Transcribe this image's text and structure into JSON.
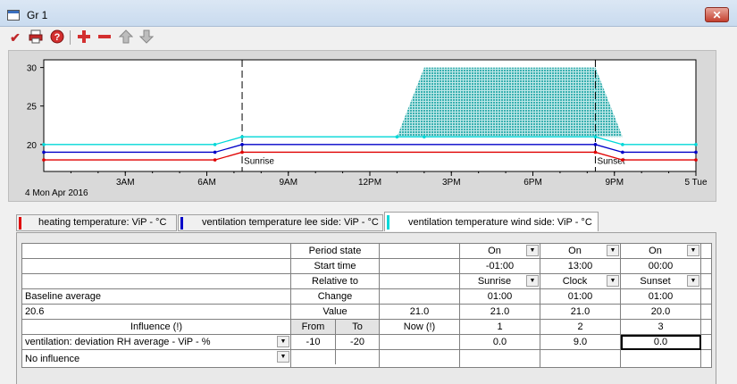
{
  "window": {
    "title": "Gr 1",
    "close_label": "✕"
  },
  "toolbar": {
    "icons": [
      "check-icon",
      "print-icon",
      "help-icon",
      "add-icon",
      "remove-icon",
      "move-up-icon",
      "move-down-icon"
    ]
  },
  "chart_data": {
    "type": "line",
    "title": "",
    "xlabel": "",
    "ylabel": "",
    "date_label": "4 Mon Apr 2016",
    "x_range": [
      0,
      24
    ],
    "x_ticks": [
      {
        "x": 3,
        "label": "3AM"
      },
      {
        "x": 6,
        "label": "6AM"
      },
      {
        "x": 9,
        "label": "9AM"
      },
      {
        "x": 12,
        "label": "12PM"
      },
      {
        "x": 15,
        "label": "3PM"
      },
      {
        "x": 18,
        "label": "6PM"
      },
      {
        "x": 21,
        "label": "9PM"
      },
      {
        "x": 24,
        "label": "5 Tue"
      }
    ],
    "y_range": [
      16.5,
      31
    ],
    "y_ticks": [
      20,
      25,
      30
    ],
    "markers": [
      {
        "x": 7.3,
        "label": "Sunrise"
      },
      {
        "x": 20.3,
        "label": "Sunset"
      }
    ],
    "series": [
      {
        "name": "heating temperature: ViP - °C",
        "color": "#e00000",
        "x": [
          0,
          6.3,
          7.3,
          20.3,
          21.3,
          24
        ],
        "y": [
          18,
          18,
          19,
          19,
          18,
          18
        ]
      },
      {
        "name": "ventilation temperature lee side: ViP - °C",
        "color": "#0000c8",
        "x": [
          0,
          6.3,
          7.3,
          20.3,
          21.3,
          24
        ],
        "y": [
          19,
          19,
          20,
          20,
          19,
          19
        ]
      },
      {
        "name": "ventilation temperature wind side: ViP - °C",
        "color": "#00d8d8",
        "x": [
          0,
          6.3,
          7.3,
          13,
          14,
          20.3,
          21.3,
          24
        ],
        "y": [
          20,
          20,
          21,
          21,
          21,
          21,
          20,
          20
        ]
      }
    ],
    "area": {
      "color": "#3ab0b0",
      "x": [
        13,
        14,
        20.3,
        21.3
      ],
      "y_top": [
        21,
        30,
        30,
        21
      ],
      "y_base": 21
    }
  },
  "tabs": [
    {
      "label": "heating temperature: ViP - °C",
      "color": "#e00000"
    },
    {
      "label": "ventilation temperature lee side: ViP - °C",
      "color": "#0000c8"
    },
    {
      "label": "ventilation temperature wind side: ViP - °C",
      "color": "#00d8d8"
    }
  ],
  "table": {
    "row_labels": [
      "Period state",
      "Start time",
      "Relative to",
      "Change",
      "Value"
    ],
    "baseline_label": "Baseline average",
    "baseline_value": "20.6",
    "value_now": "21.0",
    "columns": [
      {
        "period_state": "On",
        "start_time": "-01:00",
        "relative_to": "Sunrise",
        "change": "01:00",
        "value": "21.0"
      },
      {
        "period_state": "On",
        "start_time": "13:00",
        "relative_to": "Clock",
        "change": "01:00",
        "value": "21.0"
      },
      {
        "period_state": "On",
        "start_time": "00:00",
        "relative_to": "Sunset",
        "change": "01:00",
        "value": "20.0"
      }
    ],
    "influence_header": {
      "label": "Influence (!)",
      "from": "From",
      "to": "To",
      "now": "Now (!)",
      "p1": "1",
      "p2": "2",
      "p3": "3"
    },
    "influences": [
      {
        "name": "ventilation: deviation RH average - ViP - %",
        "from": "-10",
        "to": "-20",
        "now": "",
        "v1": "0.0",
        "v2": "9.0",
        "v3": "0.0"
      },
      {
        "name": "No influence",
        "from": "",
        "to": "",
        "now": "",
        "v1": "",
        "v2": "",
        "v3": ""
      }
    ]
  }
}
